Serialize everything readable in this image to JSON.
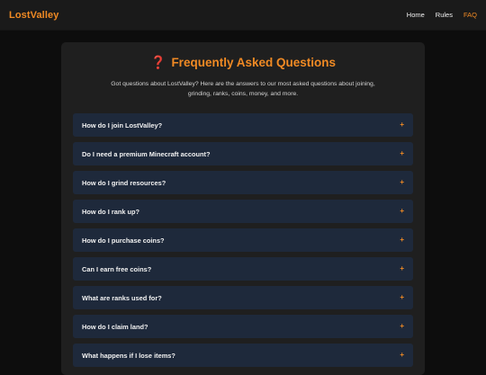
{
  "header": {
    "brand": "LostValley",
    "nav": [
      "Home",
      "Rules",
      "FAQ"
    ],
    "active": "FAQ"
  },
  "main": {
    "title_icon": "❓",
    "title": "Frequently Asked Questions",
    "intro": "Got questions about LostValley? Here are the answers to our most asked questions about joining, grinding, ranks, coins, money, and more.",
    "questions": [
      "How do I join LostValley?",
      "Do I need a premium Minecraft account?",
      "How do I grind resources?",
      "How do I rank up?",
      "How do I purchase coins?",
      "Can I earn free coins?",
      "What are ranks used for?",
      "How do I claim land?",
      "What happens if I lose items?"
    ],
    "expand_symbol": "+"
  },
  "colors": {
    "accent": "#f08a24",
    "background": "#0d0d0d",
    "card": "#1f1f1f",
    "item": "#1e293b"
  }
}
